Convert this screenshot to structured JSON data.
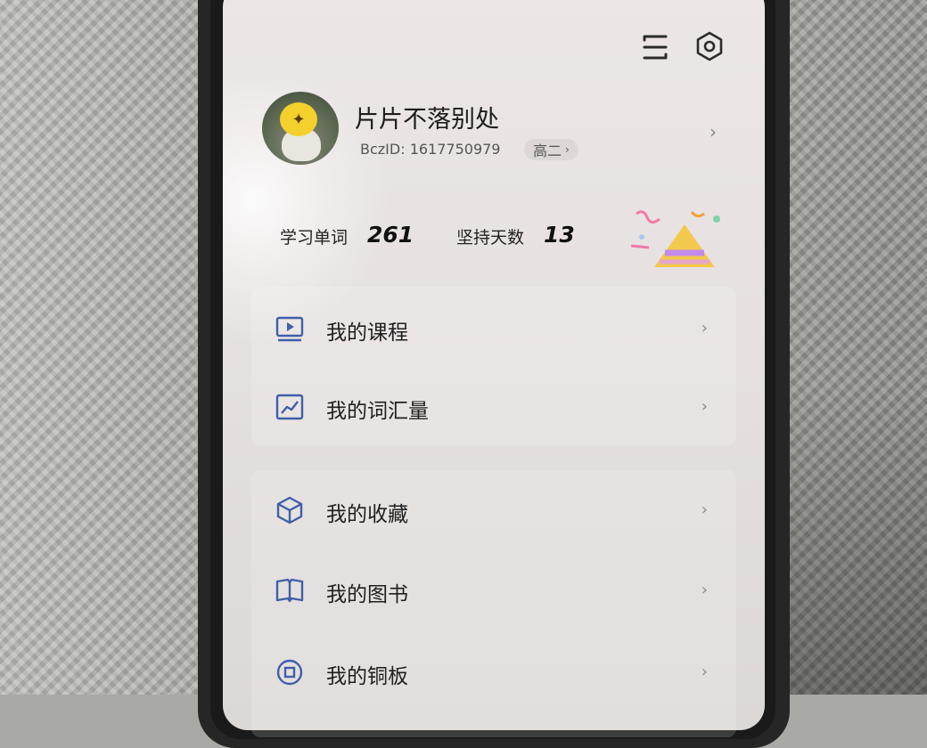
{
  "profile": {
    "username": "片片不落别处",
    "bczid": "BczID: 1617750979",
    "grade": "高二"
  },
  "stats": [
    {
      "label": "学习单词",
      "value": "261"
    },
    {
      "label": "坚持天数",
      "value": "13"
    }
  ],
  "menu": [
    {
      "label": "我的课程",
      "icon": "video-course-icon"
    },
    {
      "label": "我的词汇量",
      "icon": "trend-chart-icon"
    },
    {
      "label": "我的收藏",
      "icon": "cube-icon"
    },
    {
      "label": "我的图书",
      "icon": "open-book-icon"
    },
    {
      "label": "我的铜板",
      "icon": "coin-icon"
    }
  ],
  "colors": {
    "icon_blue": "#3f5fa8",
    "screen_bg": "#e8e3e2"
  }
}
